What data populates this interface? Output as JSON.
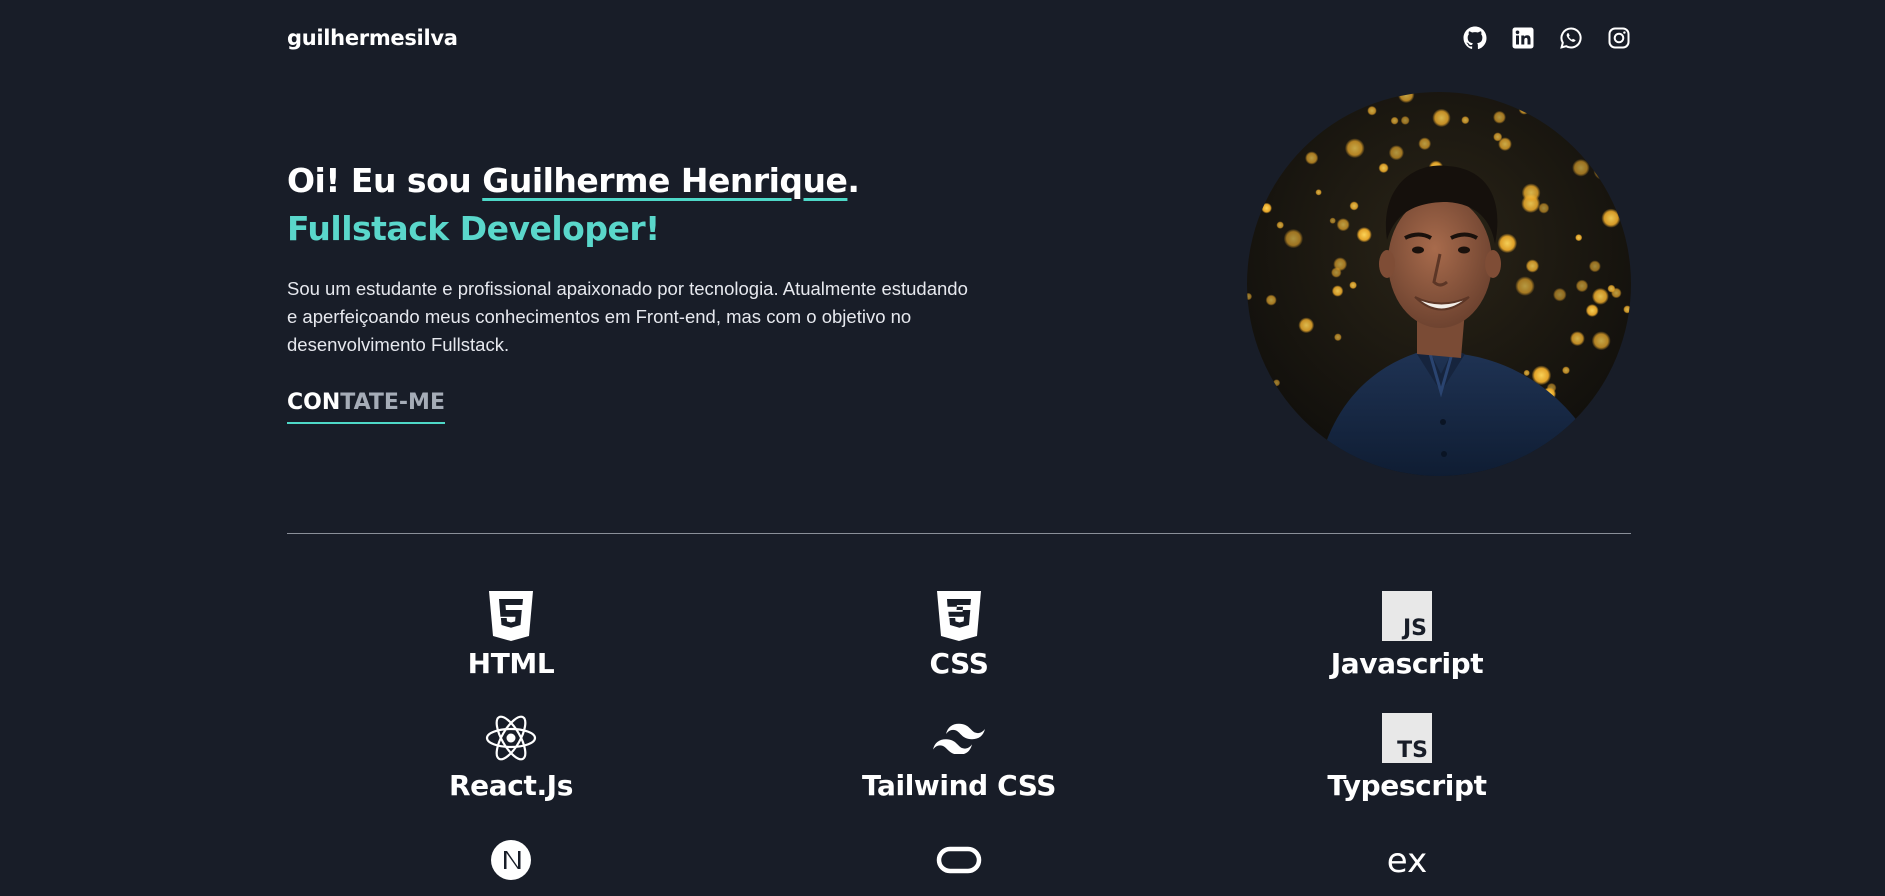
{
  "header": {
    "logo": "guilhermesilva",
    "socials": [
      {
        "icon": "github-icon"
      },
      {
        "icon": "linkedin-icon"
      },
      {
        "icon": "whatsapp-icon"
      },
      {
        "icon": "instagram-icon"
      }
    ]
  },
  "hero": {
    "greeting_prefix": "Oi! Eu sou ",
    "name": "Guilherme Henrique",
    "greeting_suffix": ".",
    "role": "Fullstack Developer!",
    "description": "Sou um estudante e profissional apaixonado por tecnologia. Atualmente estudando e aperfeiçoando meus conhecimentos em Front-end, mas com o objetivo no desenvolvimento Fullstack.",
    "contact_highlight": "CON",
    "contact_rest": "TATE-ME",
    "accent_color": "#5ad7cb"
  },
  "skills": [
    {
      "label": "HTML",
      "icon": "html5-icon"
    },
    {
      "label": "CSS",
      "icon": "css3-icon"
    },
    {
      "label": "Javascript",
      "icon": "javascript-icon"
    },
    {
      "label": "React.Js",
      "icon": "react-icon"
    },
    {
      "label": "Tailwind CSS",
      "icon": "tailwind-icon"
    },
    {
      "label": "Typescript",
      "icon": "typescript-icon"
    },
    {
      "label": "",
      "icon": "nextjs-icon"
    },
    {
      "label": "",
      "icon": "oracle-icon"
    },
    {
      "label": "",
      "icon": "express-icon"
    }
  ],
  "colors": {
    "background": "#181d28",
    "accent": "#4ed8c8",
    "text": "#ffffff"
  }
}
